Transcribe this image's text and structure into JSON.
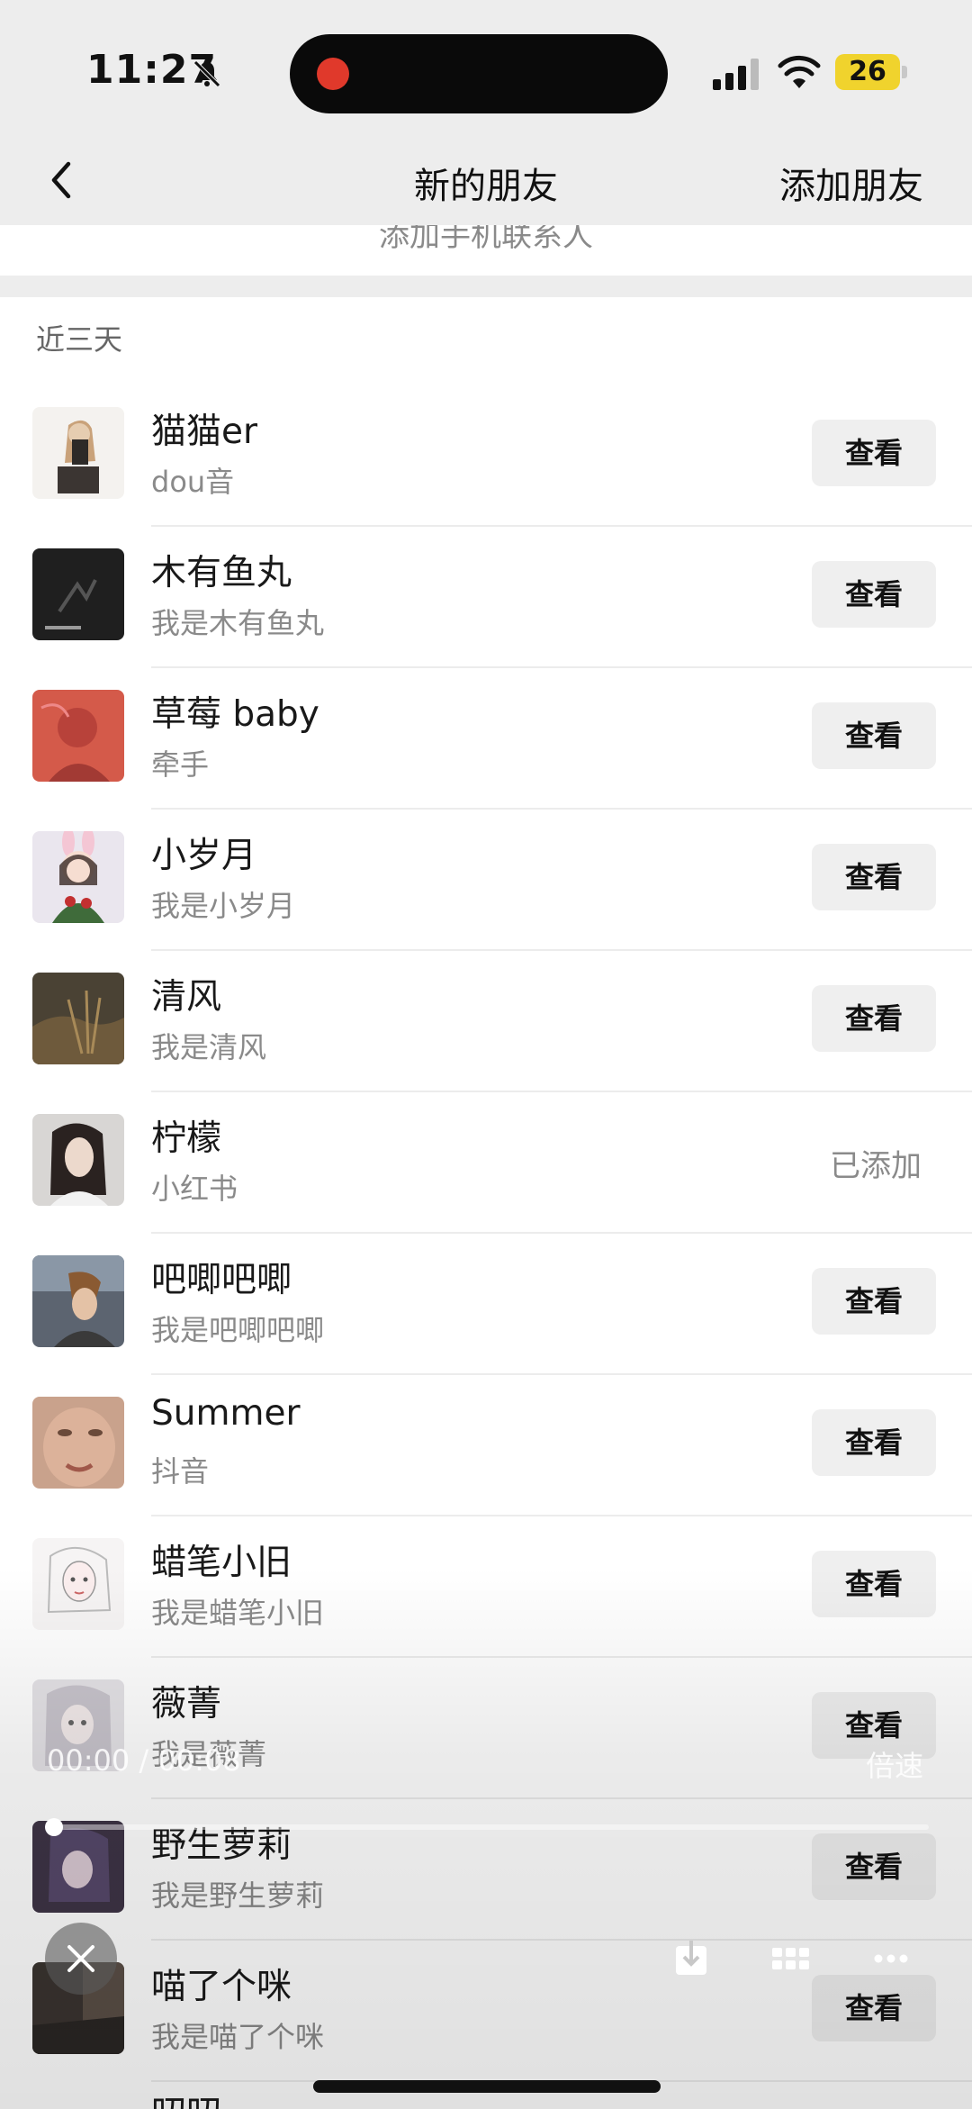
{
  "status": {
    "time": "11:27",
    "battery": "26",
    "icons": [
      "bell-off-icon",
      "signal-icon",
      "wifi-icon",
      "battery-icon"
    ]
  },
  "nav": {
    "back_icon": "chevron-left-icon",
    "title": "新的朋友",
    "action": "添加朋友"
  },
  "contacts_strip": "添加手机联系人",
  "section_label": "近三天",
  "contacts": [
    {
      "name": "猫猫er",
      "subtitle": "dou音",
      "action": "查看",
      "added": false
    },
    {
      "name": "木有鱼丸",
      "subtitle": "我是木有鱼丸",
      "action": "查看",
      "added": false
    },
    {
      "name": "草莓 baby",
      "subtitle": "牵手",
      "action": "查看",
      "added": false
    },
    {
      "name": "小岁月",
      "subtitle": "我是小岁月",
      "action": "查看",
      "added": false
    },
    {
      "name": "清风",
      "subtitle": "我是清风",
      "action": "查看",
      "added": false
    },
    {
      "name": "柠檬",
      "subtitle": "小红书",
      "action": "已添加",
      "added": true
    },
    {
      "name": "吧唧吧唧",
      "subtitle": "我是吧唧吧唧",
      "action": "查看",
      "added": false
    },
    {
      "name": "Summer",
      "subtitle": "抖音",
      "action": "查看",
      "added": false
    },
    {
      "name": "蜡笔小旧",
      "subtitle": "我是蜡笔小旧",
      "action": "查看",
      "added": false
    },
    {
      "name": "薇菁",
      "subtitle": "我是薇菁",
      "action": "查看",
      "added": false
    },
    {
      "name": "野生萝莉",
      "subtitle": "我是野生萝莉",
      "action": "查看",
      "added": false
    },
    {
      "name": "喵了个咪",
      "subtitle": "我是喵了个咪",
      "action": "查看",
      "added": false
    }
  ],
  "partial_next_name": "叨叨",
  "video_overlay": {
    "time": "00:00 / 00:08",
    "speed": "倍速",
    "progress": 0.0,
    "icons": [
      "close-icon",
      "download-icon",
      "grid-icon",
      "more-icon"
    ]
  },
  "colors": {
    "background": "#ffffff",
    "header": "#ededed",
    "button": "#efefef",
    "subtext": "#8a8a8a"
  }
}
